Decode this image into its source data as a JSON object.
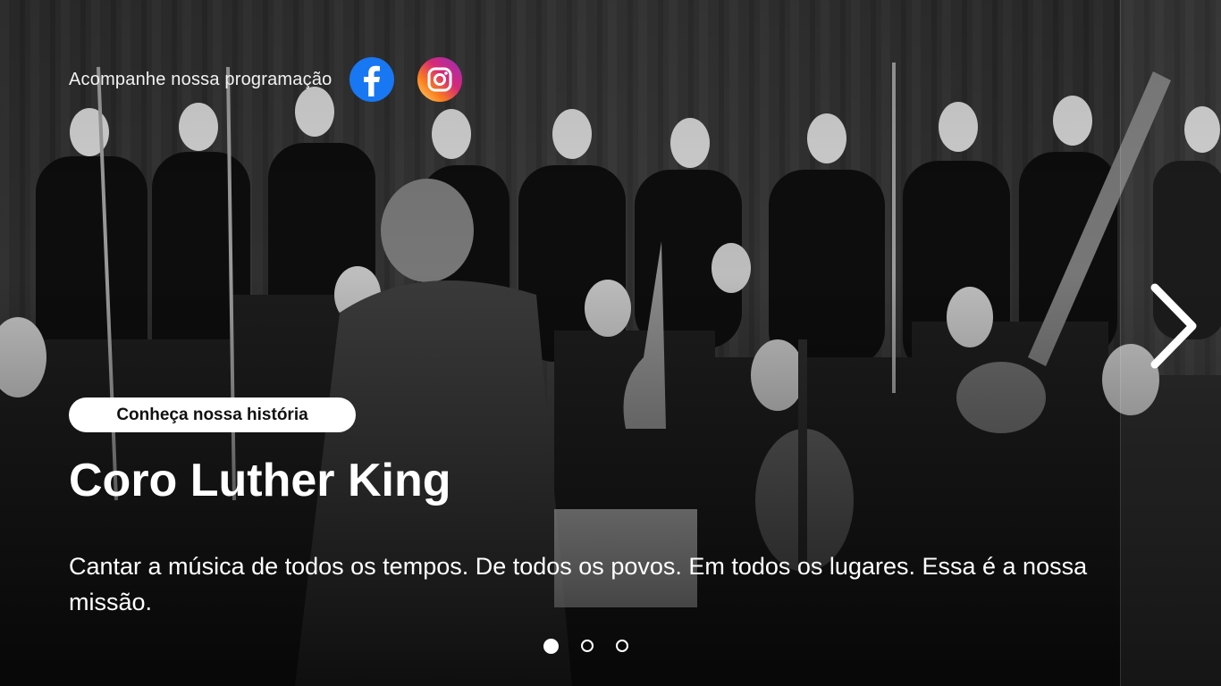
{
  "header": {
    "follow_text": "Acompanhe nossa programação",
    "social": [
      {
        "name": "facebook",
        "icon": "facebook-icon",
        "color": "#1877f2"
      },
      {
        "name": "instagram",
        "icon": "instagram-icon",
        "color": "#e1306c"
      }
    ]
  },
  "hero": {
    "cta_label": "Conheça nossa história",
    "title": "Coro Luther King",
    "subtitle": "Cantar a música de todos os tempos. De todos os povos. Em todos os lugares. Essa é a nossa missão.",
    "image": "choir-orchestra-photo"
  },
  "carousel": {
    "slide_count": 3,
    "active_index": 0,
    "next_icon": "chevron-right-icon"
  }
}
